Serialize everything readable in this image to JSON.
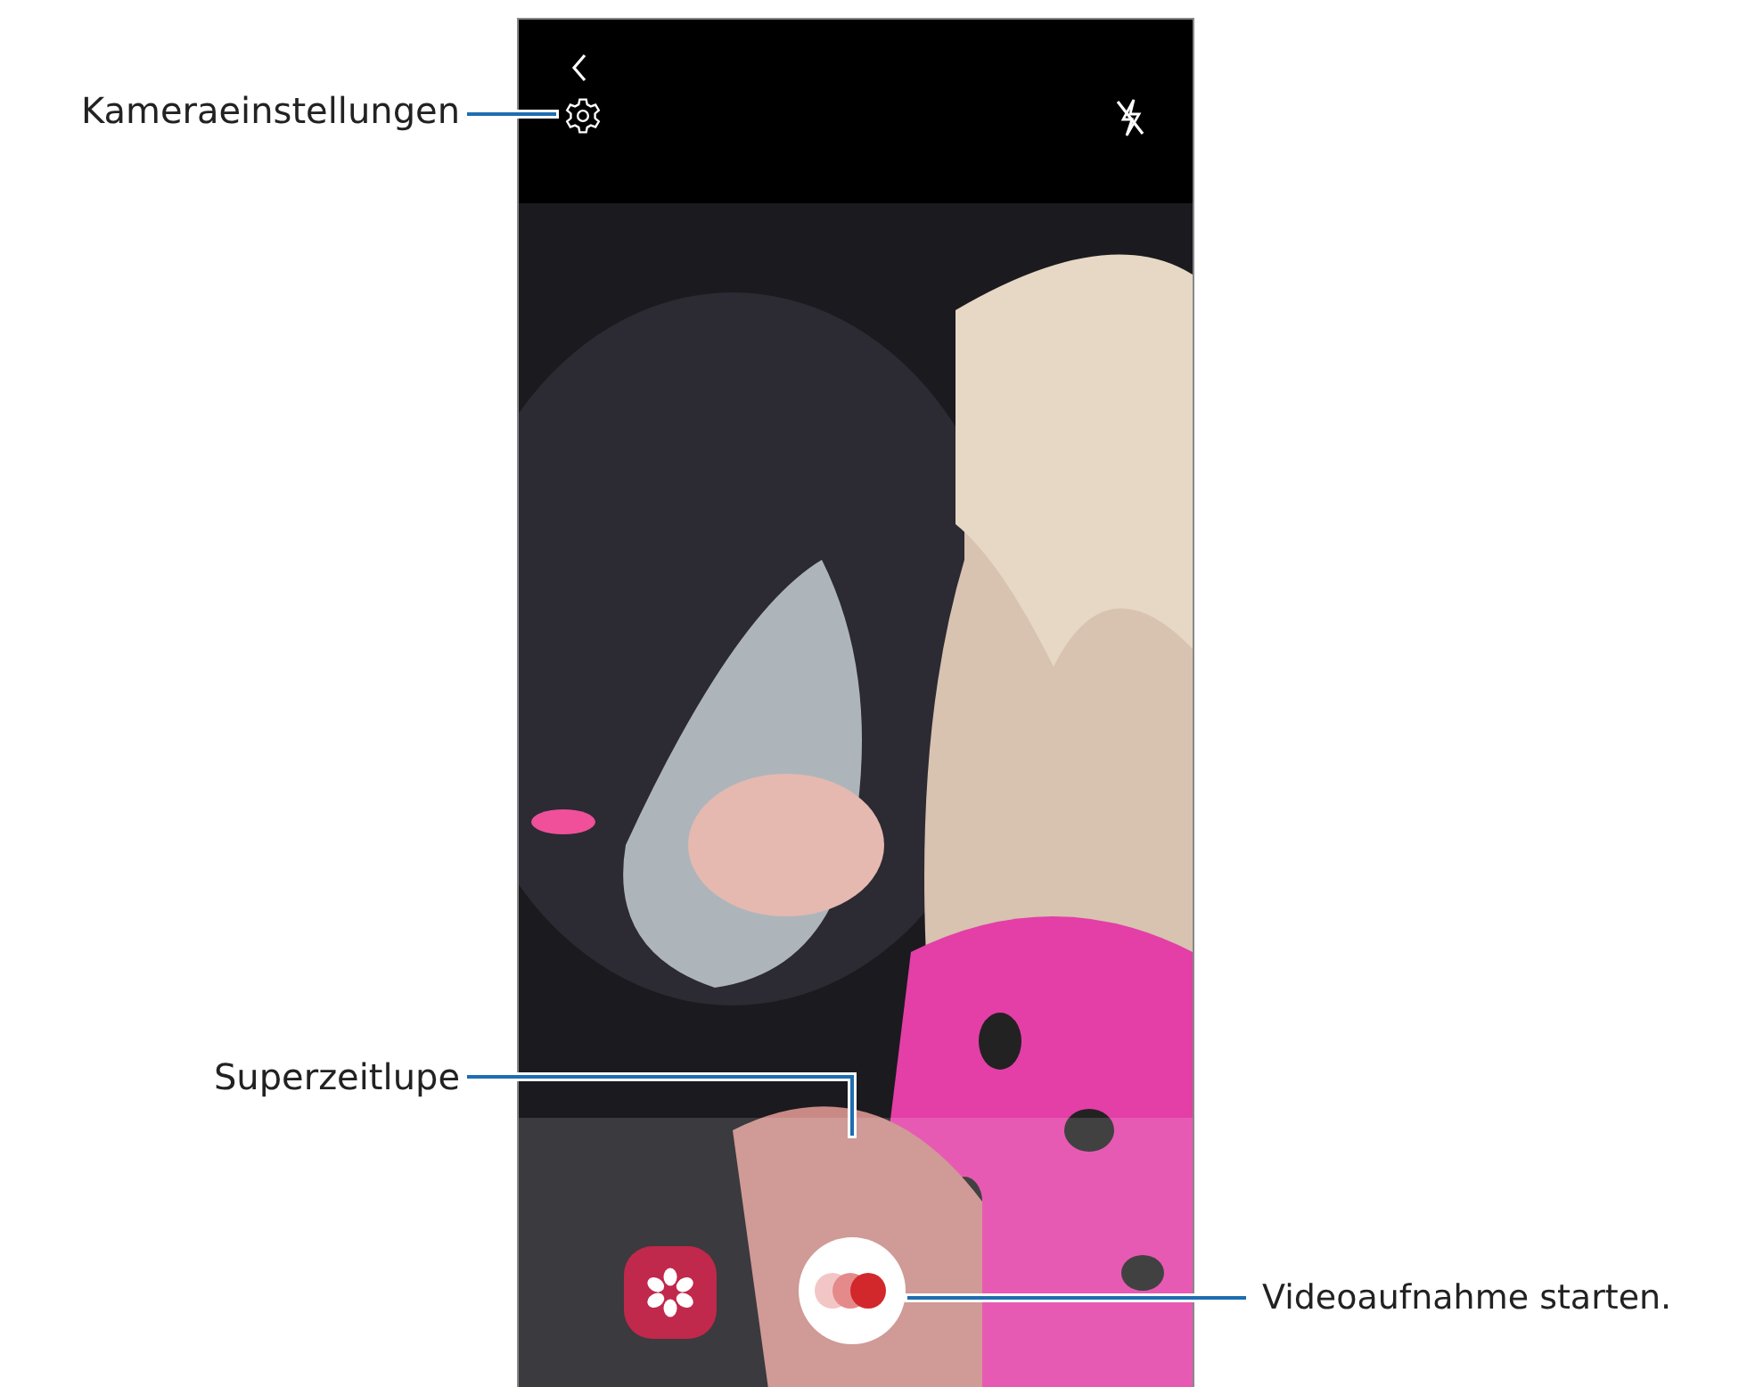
{
  "callouts": [
    {
      "kind": "settings",
      "text": "Kameraeinstellungen"
    },
    {
      "kind": "mode",
      "text": "Superzeitlupe"
    },
    {
      "kind": "record",
      "text": "Videoaufnahme starten."
    }
  ]
}
